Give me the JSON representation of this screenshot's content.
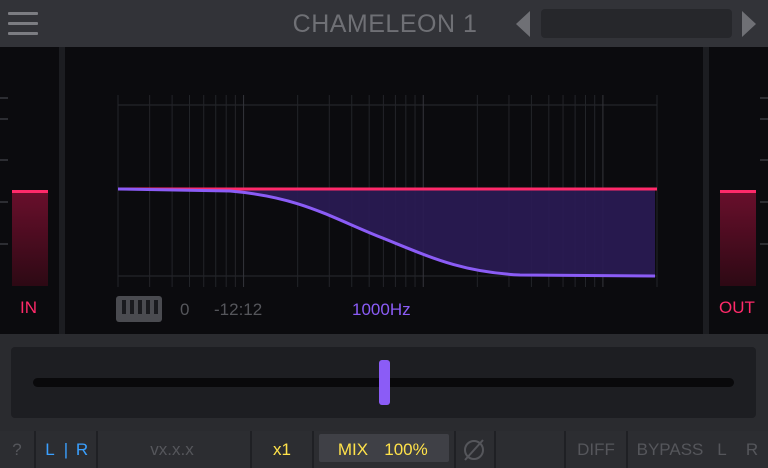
{
  "header": {
    "title": "CHAMELEON 1",
    "preset": "",
    "icons": {
      "menu": "hamburger-menu-icon",
      "prev": "triangle-left-icon",
      "next": "triangle-right-icon"
    }
  },
  "meters": {
    "in_label": "IN",
    "out_label": "OUT"
  },
  "graph": {
    "note_value": "0",
    "pitch_offset": "-12:12",
    "frequency": "1000Hz",
    "icons": {
      "piano": "piano-keys-icon"
    }
  },
  "slider": {
    "position_fraction": 0.5
  },
  "footer": {
    "help": "?",
    "channel_l": "L",
    "channel_sep": "|",
    "channel_r": "R",
    "version": "vx.x.x",
    "multiplier": "x1",
    "mix_label": "MIX",
    "mix_value": "100%",
    "phase_icon": "phase-invert-icon",
    "diff": "DIFF",
    "bypass": "BYPASS",
    "bypass_l": "L",
    "bypass_r": "R"
  },
  "colors": {
    "accent_red": "#ff2a6a",
    "accent_purple": "#8b5cf6",
    "accent_blue": "#3aa0ff",
    "accent_yellow": "#ffe24a"
  }
}
